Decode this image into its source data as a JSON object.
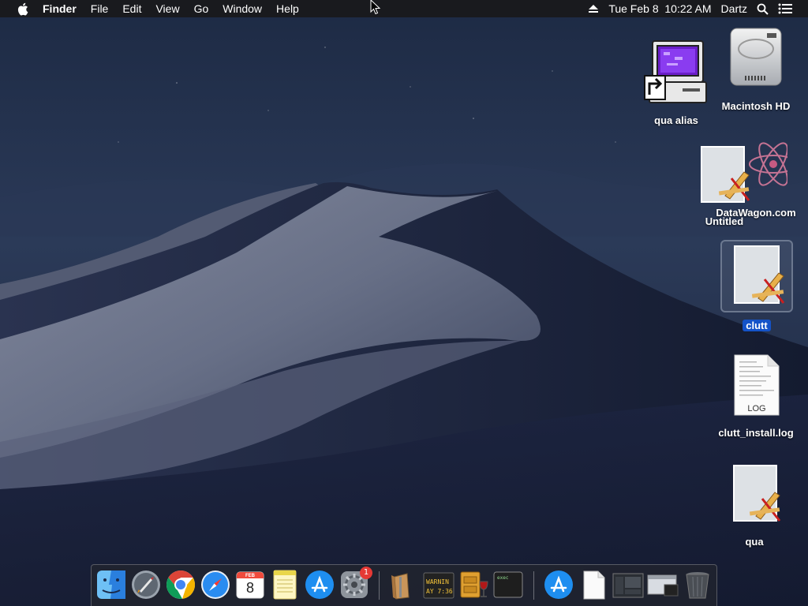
{
  "menubar": {
    "app_name": "Finder",
    "menus": [
      "File",
      "Edit",
      "View",
      "Go",
      "Window",
      "Help"
    ],
    "datetime": "Tue Feb 8  10:22 AM",
    "user": "Dartz"
  },
  "desktop_icons": {
    "qua_alias": "qua alias",
    "macintosh_hd": "Macintosh HD",
    "datawagon": "DataWagon.com",
    "untitled": "Untitled",
    "clutt": "clutt",
    "clutt_install_log": "clutt_install.log",
    "log_badge": "LOG",
    "qua": "qua"
  },
  "dock": {
    "apps": [
      "Finder",
      "Launchpad",
      "Google Chrome",
      "Safari",
      "Calendar",
      "Notes",
      "App Store",
      "System Preferences",
      "Archive Utility",
      "Console",
      "Wine File Manager",
      "Terminal",
      "App Store",
      "Document",
      "Screenshot",
      "Windows",
      "Trash"
    ],
    "calendar_month": "FEB",
    "calendar_day": "8",
    "system_prefs_badge": "1",
    "console_line1": "WARNIN",
    "console_line2": "AY 7:36",
    "terminal_text": "exec"
  },
  "colors": {
    "menubar": "#1a1a1c",
    "selection": "#1453c8",
    "badge": "#e53935"
  }
}
